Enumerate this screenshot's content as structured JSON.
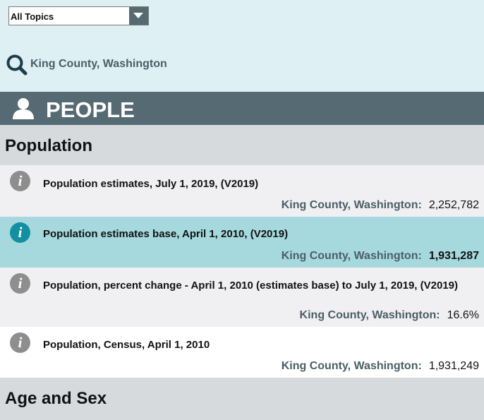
{
  "topic_filter": {
    "selected": "All Topics"
  },
  "search": {
    "label": "King County, Washington"
  },
  "people_header": {
    "title": "PEOPLE"
  },
  "sections": [
    {
      "title": "Population",
      "facts": [
        {
          "label": "Population estimates, July 1, 2019, (V2019)",
          "geography": "King County, Washington:",
          "value": "2,252,782"
        },
        {
          "label": "Population estimates base, April 1, 2010, (V2019)",
          "geography": "King County, Washington:",
          "value": "1,931,287"
        },
        {
          "label": "Population, percent change - April 1, 2010 (estimates base) to July 1, 2019, (V2019)",
          "geography": "King County, Washington:",
          "value": "16.6%"
        },
        {
          "label": "Population, Census, April 1, 2010",
          "geography": "King County, Washington:",
          "value": "1,931,249"
        }
      ]
    },
    {
      "title": "Age and Sex"
    }
  ],
  "icons": {
    "info": "i"
  },
  "colors": {
    "header": "#556a73",
    "highlight": "#a6d9de",
    "info_active": "#128fa1",
    "info": "#8e8e8e",
    "panel": "#dff0f4"
  }
}
